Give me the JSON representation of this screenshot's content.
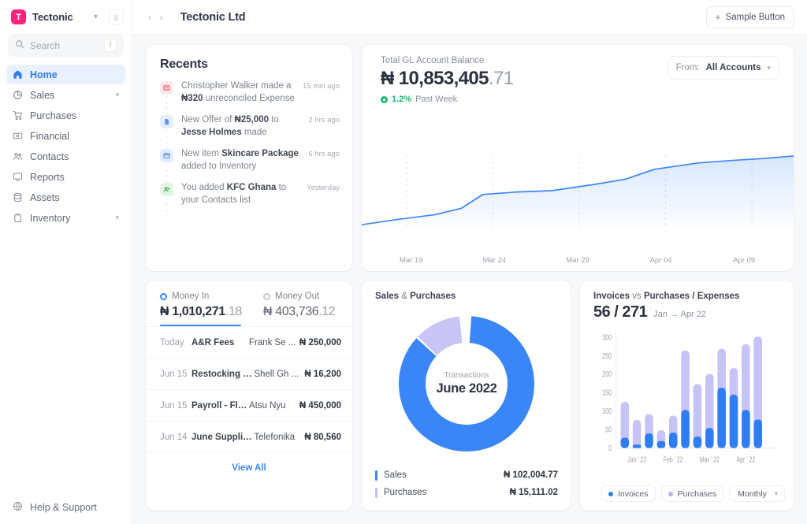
{
  "sidebar": {
    "brand": {
      "badge_letter": "T",
      "name": "Tectonic",
      "caret_icon": "chevron-down-icon",
      "collapse_icon": "collapse-panel-icon",
      "collapse_label": "|(",
      "accent": "#f9247e"
    },
    "search": {
      "placeholder": "Search",
      "icon": "search-icon",
      "shortcut": "/"
    },
    "items": [
      {
        "label": "Home",
        "icon": "home-icon",
        "active": true,
        "has_caret": false
      },
      {
        "label": "Sales",
        "icon": "pie-chart-icon",
        "active": false,
        "has_caret": true
      },
      {
        "label": "Purchases",
        "icon": "shopping-cart-icon",
        "active": false,
        "has_caret": false
      },
      {
        "label": "Financial",
        "icon": "bank-note-icon",
        "active": false,
        "has_caret": false
      },
      {
        "label": "Contacts",
        "icon": "people-icon",
        "active": false,
        "has_caret": false
      },
      {
        "label": "Reports",
        "icon": "report-icon",
        "active": false,
        "has_caret": false
      },
      {
        "label": "Assets",
        "icon": "database-icon",
        "active": false,
        "has_caret": false
      },
      {
        "label": "Inventory",
        "icon": "clipboard-icon",
        "active": false,
        "has_caret": true
      }
    ],
    "help": {
      "label": "Help & Support",
      "icon": "help-circle-icon"
    }
  },
  "topbar": {
    "back_icon": "chevron-left-icon",
    "forward_icon": "chevron-right-icon",
    "title": "Tectonic Ltd",
    "sample_button": {
      "label": "Sample Button",
      "icon": "plus-icon"
    }
  },
  "recents": {
    "title": "Recents",
    "items": [
      {
        "icon": "expense-icon",
        "badge_bg": "#fde8ea",
        "badge_fg": "#ec4a5a",
        "pre": "Christopher Walker made a ",
        "strong": "₦320",
        "post": " unreconciled Expense",
        "time": "15 min ago"
      },
      {
        "icon": "document-icon",
        "badge_bg": "#e4eefd",
        "badge_fg": "#4a8ef0",
        "pre": "New Offer of ",
        "strong": "₦25,000",
        "post": " to ",
        "strong2": "Jesse Holmes",
        "post2": " made",
        "time": "2 hrs ago"
      },
      {
        "icon": "inventory-box-icon",
        "badge_bg": "#e1ecfc",
        "badge_fg": "#4a8ef0",
        "pre": "New item ",
        "strong": "Skincare Package",
        "post": " added to Inventory",
        "time": "6 hrs ago"
      },
      {
        "icon": "add-contact-icon",
        "badge_bg": "#e4f6e3",
        "badge_fg": "#4fb158",
        "pre": "You added ",
        "strong": "KFC Ghana",
        "post": " to your Contacts list",
        "time": "Yesterday"
      }
    ]
  },
  "gl_balance": {
    "label": "Total GL Account Balance",
    "amount_main": "₦ 10,853,405",
    "amount_dec": ".71",
    "delta_pct": "1.2%",
    "delta_period": "Past Week",
    "delta_color": "#17b96b",
    "filter": {
      "prefix": "From:",
      "value": "All Accounts",
      "caret_icon": "chevron-down-icon"
    }
  },
  "money": {
    "tabs": [
      {
        "label": "Money In",
        "value_main": "₦ 1,010,271",
        "value_dec": ".18",
        "active": true
      },
      {
        "label": "Money Out",
        "value_main": "₦ 403,736",
        "value_dec": ".12",
        "active": false
      }
    ],
    "transactions": [
      {
        "date": "Today",
        "desc": "A&R Fees",
        "who": "Frank Se ...",
        "amount": "₦ 250,000"
      },
      {
        "date": "Jun 15",
        "desc": "Restocking Fee",
        "who": "Shell Gh ...",
        "amount": "₦ 16,200"
      },
      {
        "date": "Jun 15",
        "desc": "Payroll - Flats",
        "who": "Atsu Nyu",
        "amount": "₦ 450,000"
      },
      {
        "date": "Jun 14",
        "desc": "June Supplies ...",
        "who": "Telefonika",
        "amount": "₦ 80,560"
      }
    ],
    "view_all": "View All"
  },
  "donut": {
    "title_a": "Sales",
    "title_amp": "&",
    "title_b": "Purchases",
    "center_sub": "Transactions",
    "center_main": "June 2022",
    "legend": [
      {
        "name": "Sales",
        "value": "₦ 102,004.77",
        "color": "#3b86f7"
      },
      {
        "name": "Purchases",
        "value": "₦ 15,111.02",
        "color": "#c3c0f5"
      }
    ]
  },
  "bars": {
    "title_a": "Invoices",
    "title_vs": "vs",
    "title_b": "Purchases / Expenses",
    "headline": "56 / 271",
    "range": "Jan → Apr 22",
    "legend": [
      {
        "label": "Invoices",
        "color": "#2f7df4"
      },
      {
        "label": "Purchases",
        "color": "#b9b4f2"
      }
    ],
    "period_select": {
      "value": "Monthly",
      "caret_icon": "chevron-down-icon"
    }
  },
  "chart_data": [
    {
      "type": "area",
      "title": "Total GL Account Balance",
      "xlabel": "",
      "ylabel": "",
      "grid": true,
      "legend_position": "none",
      "line_color": "#3b86f7",
      "x": [
        "Mar 19",
        "Mar 24",
        "Mar 29",
        "Apr 04",
        "Apr 09"
      ],
      "tick_labels": [
        "Mar 19",
        "Mar 24",
        "Mar 29",
        "Apr 04",
        "Apr 09"
      ],
      "points": [
        {
          "x": 0,
          "y": 8
        },
        {
          "x": 8,
          "y": 12
        },
        {
          "x": 17,
          "y": 16
        },
        {
          "x": 23,
          "y": 21
        },
        {
          "x": 28,
          "y": 33
        },
        {
          "x": 36,
          "y": 35
        },
        {
          "x": 44,
          "y": 36
        },
        {
          "x": 54,
          "y": 42
        },
        {
          "x": 61,
          "y": 47
        },
        {
          "x": 68,
          "y": 60
        },
        {
          "x": 78,
          "y": 76
        },
        {
          "x": 86,
          "y": 80
        },
        {
          "x": 93,
          "y": 85
        },
        {
          "x": 100,
          "y": 92
        }
      ],
      "ylim": [
        0,
        100
      ]
    },
    {
      "type": "pie",
      "title": "Sales & Purchases",
      "center_label": "Transactions / June 2022",
      "labels": [
        "Sales",
        "Purchases"
      ],
      "values": [
        102004.77,
        15111.02
      ],
      "percent": [
        87.1,
        12.9
      ],
      "colors": [
        "#3b86f7",
        "#c3c0f5"
      ],
      "legend_position": "bottom"
    },
    {
      "type": "bar",
      "title": "Invoices vs Purchases / Expenses",
      "stacked": true,
      "grid": true,
      "legend_position": "bottom",
      "xlabel": "",
      "ylabel": "",
      "ylim": [
        0,
        300
      ],
      "yticks": [
        0,
        50,
        100,
        150,
        200,
        250,
        300
      ],
      "categories": [
        "Jan '22",
        "Feb '22",
        "Mar '22",
        "Apr '22"
      ],
      "bar_count": 12,
      "tick_positions": [
        1.5,
        4.5,
        7.5,
        10.5
      ],
      "series": [
        {
          "name": "Invoices",
          "color": "#2f7df4",
          "values": [
            28,
            9,
            40,
            19,
            42,
            99,
            30,
            52,
            157,
            139,
            99,
            74
          ]
        },
        {
          "name": "Purchases",
          "color": "#c3c0f5",
          "values": [
            120,
            73,
            88,
            46,
            84,
            254,
            166,
            193,
            258,
            207,
            270,
            291
          ]
        }
      ]
    }
  ]
}
